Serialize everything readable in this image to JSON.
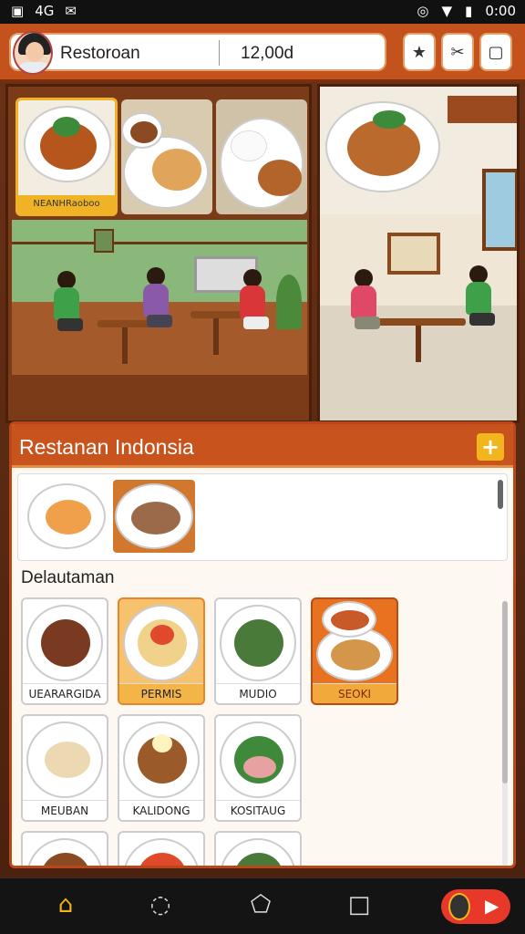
{
  "status_bar": {
    "time": "0:00",
    "carrier": "4G"
  },
  "header": {
    "restaurant_name": "Restoroan",
    "balance": "12,00d"
  },
  "toolbar": {
    "star_icon": "★",
    "tools_icon": "✂",
    "menu_icon": "▢"
  },
  "scene": {
    "card_label": "NEANHRaoboo"
  },
  "panel": {
    "title": "Restanan Indonsia",
    "add_label": "+",
    "section_title": "Delautaman",
    "dishes": [
      {
        "label": "UEARARGIDA",
        "state": "normal"
      },
      {
        "label": "PERMIS",
        "state": "selected"
      },
      {
        "label": "MUDIO",
        "state": "normal"
      },
      {
        "label": "SEOKI",
        "state": "highlight"
      },
      {
        "label": "MEUBAN",
        "state": "normal"
      },
      {
        "label": "KALIDONG",
        "state": "normal"
      },
      {
        "label": "KOSITAUG",
        "state": "normal"
      }
    ]
  },
  "nav": {
    "home_icon": "⌂",
    "refresh_icon": "◌",
    "pentagon_icon": "⬠",
    "square_icon": "□",
    "play_icon": "▶"
  },
  "colors": {
    "brand": "#c9531d",
    "accent": "#f2b51d"
  }
}
